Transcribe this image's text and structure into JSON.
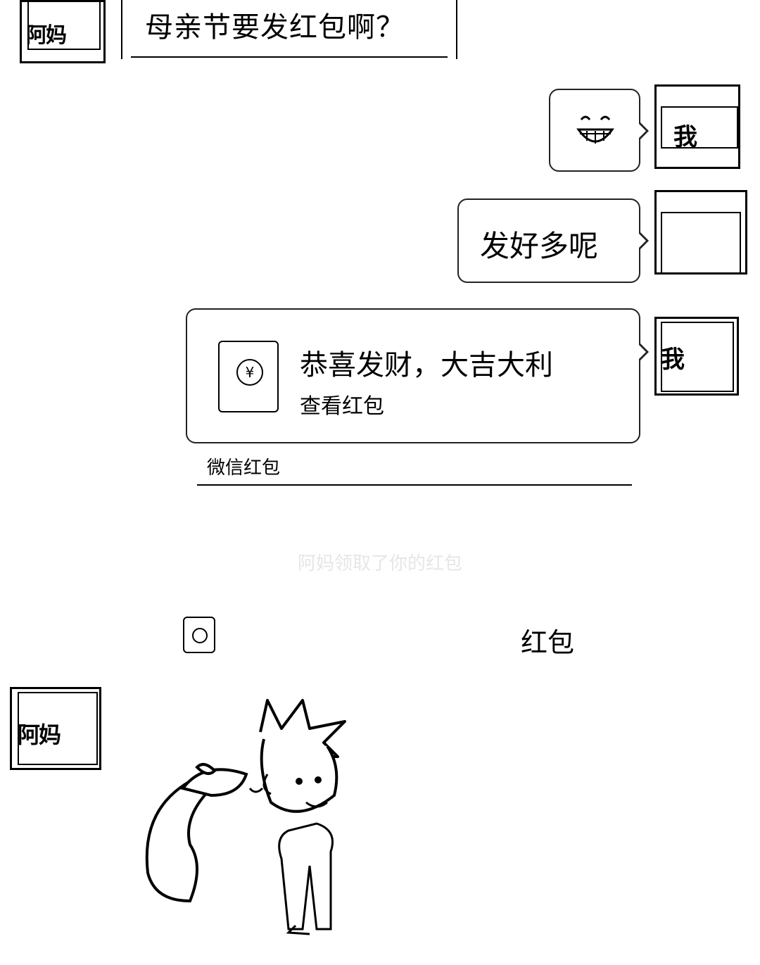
{
  "messages": {
    "top_left_avatar_name": "阿妈",
    "question_text": "母亲节要发红包啊？",
    "laugh_emoji": "😁",
    "reply_text": "发好多呢",
    "right_avatar_name": "我"
  },
  "red_packet": {
    "icon_symbol": "¥",
    "greeting": "恭喜发财，大吉大利",
    "action": "查看红包",
    "footer": "微信红包"
  },
  "system": {
    "notice_text": "阿妈领取了你的红包",
    "notice_faded": "",
    "row_text": "红包"
  },
  "bottom": {
    "avatar_name": "阿妈"
  }
}
